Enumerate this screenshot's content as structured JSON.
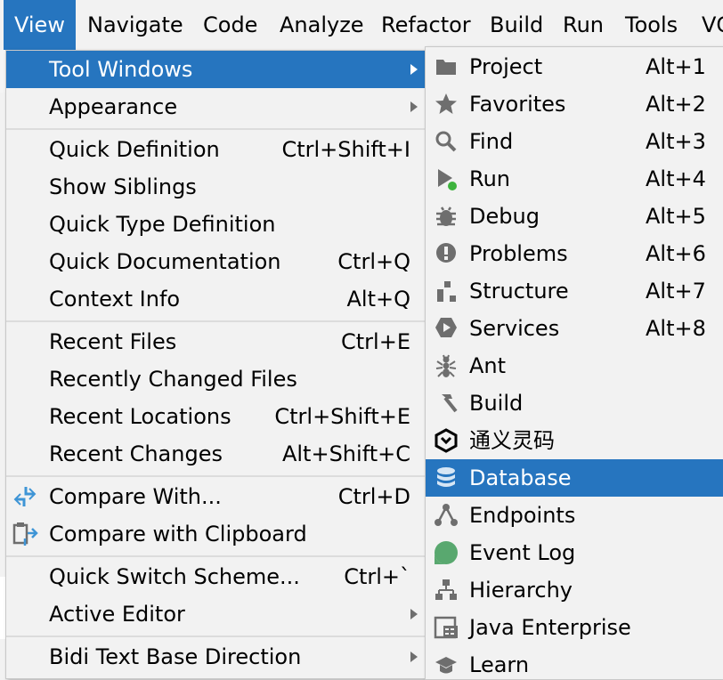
{
  "menubar": {
    "items": [
      {
        "label": "View",
        "active": true
      },
      {
        "label": "Navigate"
      },
      {
        "label": "Code"
      },
      {
        "label": "Analyze"
      },
      {
        "label": "Refactor"
      },
      {
        "label": "Build"
      },
      {
        "label": "Run"
      },
      {
        "label": "Tools"
      },
      {
        "label": "VC"
      }
    ]
  },
  "view_menu": {
    "items": [
      {
        "label": "Tool Windows",
        "shortcut": "",
        "submenu": true,
        "selected": true
      },
      {
        "label": "Appearance",
        "shortcut": "",
        "submenu": true
      },
      {
        "label": "Quick Definition",
        "shortcut": "Ctrl+Shift+I"
      },
      {
        "label": "Show Siblings",
        "shortcut": ""
      },
      {
        "label": "Quick Type Definition",
        "shortcut": ""
      },
      {
        "label": "Quick Documentation",
        "shortcut": "Ctrl+Q"
      },
      {
        "label": "Context Info",
        "shortcut": "Alt+Q"
      },
      {
        "label": "Recent Files",
        "shortcut": "Ctrl+E"
      },
      {
        "label": "Recently Changed Files",
        "shortcut": ""
      },
      {
        "label": "Recent Locations",
        "shortcut": "Ctrl+Shift+E"
      },
      {
        "label": "Recent Changes",
        "shortcut": "Alt+Shift+C"
      },
      {
        "label": "Compare With...",
        "shortcut": "Ctrl+D",
        "icon": "compare-icon"
      },
      {
        "label": "Compare with Clipboard",
        "shortcut": "",
        "icon": "compare-clipboard-icon"
      },
      {
        "label": "Quick Switch Scheme...",
        "shortcut": "Ctrl+`"
      },
      {
        "label": "Active Editor",
        "shortcut": "",
        "submenu": true
      },
      {
        "label": "Bidi Text Base Direction",
        "shortcut": "",
        "submenu": true
      }
    ]
  },
  "tool_windows_menu": {
    "items": [
      {
        "label": "Project",
        "shortcut": "Alt+1",
        "icon": "folder-icon"
      },
      {
        "label": "Favorites",
        "shortcut": "Alt+2",
        "icon": "star-icon"
      },
      {
        "label": "Find",
        "shortcut": "Alt+3",
        "icon": "search-icon"
      },
      {
        "label": "Run",
        "shortcut": "Alt+4",
        "icon": "run-icon"
      },
      {
        "label": "Debug",
        "shortcut": "Alt+5",
        "icon": "bug-icon"
      },
      {
        "label": "Problems",
        "shortcut": "Alt+6",
        "icon": "problems-icon"
      },
      {
        "label": "Structure",
        "shortcut": "Alt+7",
        "icon": "structure-icon"
      },
      {
        "label": "Services",
        "shortcut": "Alt+8",
        "icon": "services-icon"
      },
      {
        "label": "Ant",
        "shortcut": "",
        "icon": "ant-icon"
      },
      {
        "label": "Build",
        "shortcut": "",
        "icon": "hammer-icon"
      },
      {
        "label": "通义灵码",
        "shortcut": "",
        "icon": "tongyi-icon"
      },
      {
        "label": "Database",
        "shortcut": "",
        "icon": "database-icon",
        "selected": true
      },
      {
        "label": "Endpoints",
        "shortcut": "",
        "icon": "endpoints-icon"
      },
      {
        "label": "Event Log",
        "shortcut": "",
        "icon": "event-log-icon"
      },
      {
        "label": "Hierarchy",
        "shortcut": "",
        "icon": "hierarchy-icon"
      },
      {
        "label": "Java Enterprise",
        "shortcut": "",
        "icon": "java-enterprise-icon"
      },
      {
        "label": "Learn",
        "shortcut": "",
        "icon": "learn-icon"
      }
    ]
  },
  "colors": {
    "accent": "#2675bf",
    "menu_bg": "#f2f2f2",
    "separator": "#dcdcdc",
    "icon_gray": "#6e6e6e",
    "run_green": "#3db33d",
    "event_log_green": "#59a86f",
    "compare_blue": "#3f95d6"
  }
}
